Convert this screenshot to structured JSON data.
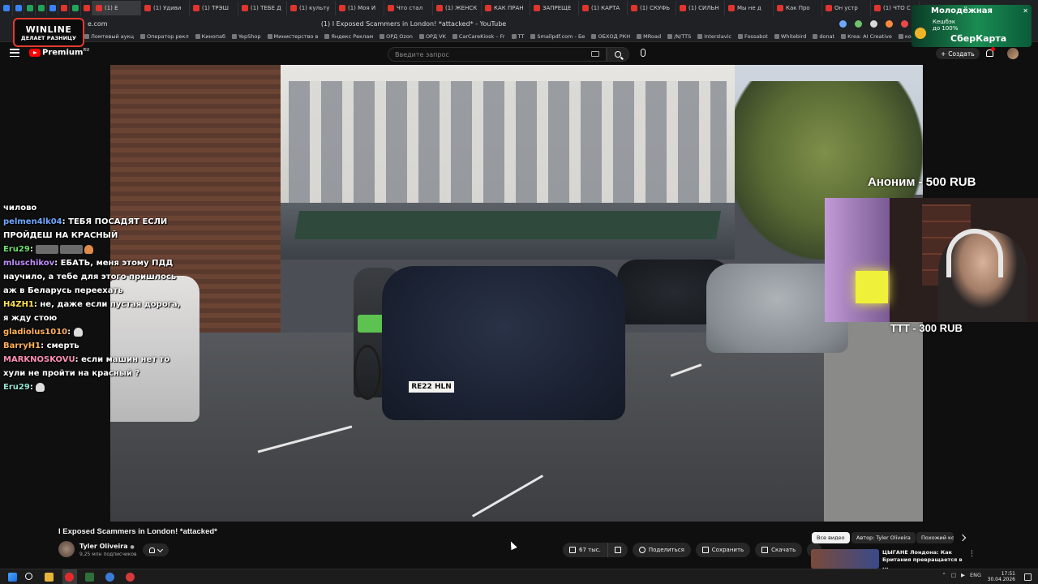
{
  "browser": {
    "tabs": [
      {
        "label": "(1) Е",
        "active": true
      },
      {
        "label": "(1) Удиви"
      },
      {
        "label": "(1) ТРЭШ"
      },
      {
        "label": "(1) ТЕБЕ Д"
      },
      {
        "label": "(1) культу"
      },
      {
        "label": "(1) Моя И"
      },
      {
        "label": "Что стал"
      },
      {
        "label": "(1) ЖЕНСК"
      },
      {
        "label": "КАК ПРАН"
      },
      {
        "label": "ЗАПРЕЩЕ"
      },
      {
        "label": "(1) КАРТА"
      },
      {
        "label": "(1) СКУФЬ"
      },
      {
        "label": "(1) СИЛЬН"
      },
      {
        "label": "Мы не д"
      },
      {
        "label": "Как Про"
      },
      {
        "label": "Он устр"
      },
      {
        "label": "(1) ЧТО С"
      }
    ],
    "url": "e.com",
    "page_title": "(1) I Exposed Scammers in London! *attacked* - YouTube",
    "bookmarks": [
      "Ломтевый аукц",
      "Оператор рекл",
      "Кинопаб",
      "YepShop",
      "Министерство в",
      "Яндекс Реклам",
      "ОРД Ozon",
      "ОРД VK",
      "CarCareKiosk – Fr",
      "TT",
      "Smallpdf.com - Бе",
      "ОБХОД РКН",
      "MRoad",
      "/N/TTS",
      "Interslavic",
      "Fossabot",
      "Whitebird",
      "donat",
      "Krea: AI Creative",
      "кобальт"
    ]
  },
  "ads": {
    "winline": {
      "brand": "WINLINE",
      "slogan": "ДЕЛАЕТ РАЗНИЦУ"
    },
    "sber": {
      "line1": "Молодёжная",
      "line2": "Кешбэк",
      "line3": "до 100%",
      "brand": "СберКарта"
    }
  },
  "youtube": {
    "brand": "Premium",
    "brand_region": "RU",
    "search_placeholder": "Введите запрос",
    "create_label": "Создать"
  },
  "video": {
    "plate_text": "RE22 HLN",
    "title": "I Exposed Scammers in London! *attacked*",
    "channel_name": "Tyler Oliveira",
    "channel_subscribers": "9,25 млн подписчиков",
    "likes": "67 тыс.",
    "share_label": "Поделиться",
    "save_label": "Сохранить",
    "download_label": "Скачать"
  },
  "chat": [
    {
      "user": "",
      "text": "чиловo"
    },
    {
      "user": "pelmen4lk04",
      "text": "ТЕБЯ ПОСАДЯТ ЕСЛИ ПРОЙДЕШ НА КРАСНЫЙ",
      "color": "#6ea8ff"
    },
    {
      "user": "Eru29",
      "text": "",
      "emotes": 3,
      "color": "#6ee06e"
    },
    {
      "user": "mluschikov",
      "text": "ЕБАТЬ, меня этому ПДД научило, а тебе для этого пришлось аж в Беларусь переехать",
      "color": "#c08cff"
    },
    {
      "user": "H4ZH1",
      "text": "не, даже если пустая дорога, я жду стою",
      "color": "#ffe34d"
    },
    {
      "user": "gladiolus1010",
      "text": "",
      "ghost": true,
      "color": "#ffb15a"
    },
    {
      "user": "BarryH1",
      "text": "смерть",
      "color": "#ffb15a"
    },
    {
      "user": "MARKNOSKOVU",
      "text": "если машин нет то хули не пройти на красный ?",
      "color": "#ff8fb5"
    },
    {
      "user": "Eru29",
      "text": "",
      "ghost": true,
      "color": "#8fe3d0"
    }
  ],
  "donations": {
    "first": "Аноним - 500 RUB",
    "second": "TTT - 300 RUB"
  },
  "chips": [
    {
      "label": "Все видео",
      "active": true
    },
    {
      "label": "Автор: Tyler Oliveira"
    },
    {
      "label": "Похожий ко"
    }
  ],
  "recommendation": {
    "title": "ЦЫГАНЕ Лондона: Как Британия превращается в ..."
  },
  "taskbar": {
    "language": "ENG",
    "time": "17:51",
    "date": "30.04.2026"
  }
}
